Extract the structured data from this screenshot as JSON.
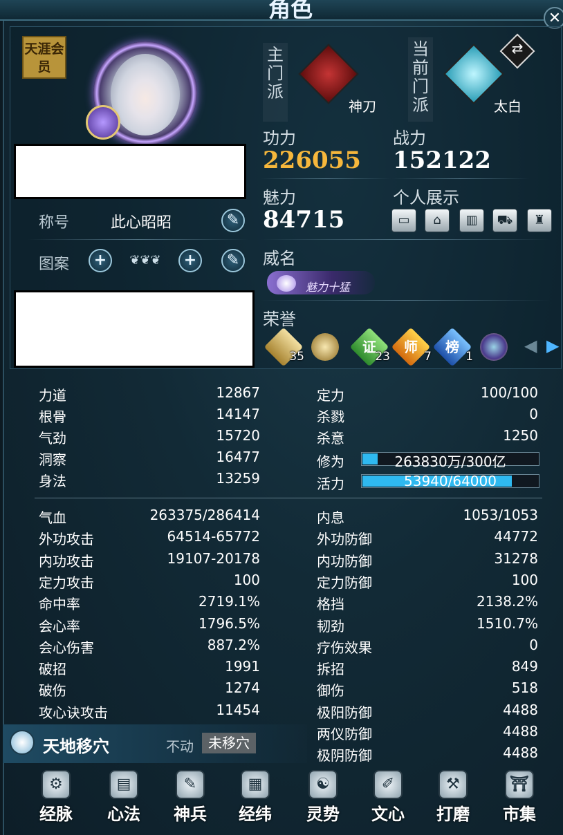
{
  "window": {
    "title": "角色",
    "close_label": "✕"
  },
  "profile": {
    "member_badge": "天涯会员",
    "title_label": "称号",
    "title_value": "此心昭昭",
    "pattern_label": "图案"
  },
  "schools": {
    "main_label": "主门派",
    "main_name": "神刀",
    "current_label": "当前门派",
    "current_name": "太白"
  },
  "stats_top": {
    "gongli_label": "功力",
    "gongli_value": "226055",
    "zhanli_label": "战力",
    "zhanli_value": "152122",
    "meili_label": "魅力",
    "meili_value": "84715",
    "showcase_label": "个人展示",
    "weiming_label": "威名",
    "weiming_badge": "魅力十猛",
    "honor_label": "荣誉"
  },
  "honors": [
    {
      "icon": "scroll-icon",
      "count": "35"
    },
    {
      "icon": "palette-icon",
      "count": ""
    },
    {
      "icon": "证",
      "count": "23"
    },
    {
      "icon": "师",
      "count": "7"
    },
    {
      "icon": "榜",
      "count": "1"
    },
    {
      "icon": "compass-icon",
      "count": ""
    }
  ],
  "attributes_left": [
    {
      "k": "力道",
      "v": "12867"
    },
    {
      "k": "根骨",
      "v": "14147"
    },
    {
      "k": "气劲",
      "v": "15720"
    },
    {
      "k": "洞察",
      "v": "16477"
    },
    {
      "k": "身法",
      "v": "13259"
    }
  ],
  "attributes_right": [
    {
      "k": "定力",
      "v": "100/100"
    },
    {
      "k": "杀戮",
      "v": "0"
    },
    {
      "k": "杀意",
      "v": "1250"
    }
  ],
  "bars": {
    "xiuwei_label": "修为",
    "xiuwei_text": "263830万/300亿",
    "xiuwei_fraction": 0.0088,
    "huoli_label": "活力",
    "huoli_text": "53940/64000",
    "huoli_fraction": 0.843
  },
  "combat_left": [
    {
      "k": "气血",
      "v": "263375/286414"
    },
    {
      "k": "外功攻击",
      "v": "64514-65772"
    },
    {
      "k": "内功攻击",
      "v": "19107-20178"
    },
    {
      "k": "定力攻击",
      "v": "100"
    },
    {
      "k": "命中率",
      "v": "2719.1%"
    },
    {
      "k": "会心率",
      "v": "1796.5%"
    },
    {
      "k": "会心伤害",
      "v": "887.2%"
    },
    {
      "k": "破招",
      "v": "1991"
    },
    {
      "k": "破伤",
      "v": "1274"
    },
    {
      "k": "攻心诀攻击",
      "v": "11454"
    }
  ],
  "combat_right": [
    {
      "k": "内息",
      "v": "1053/1053"
    },
    {
      "k": "外功防御",
      "v": "44772"
    },
    {
      "k": "内功防御",
      "v": "31278"
    },
    {
      "k": "定力防御",
      "v": "100"
    },
    {
      "k": "格挡",
      "v": "2138.2%"
    },
    {
      "k": "韧劲",
      "v": "1510.7%"
    },
    {
      "k": "疗伤效果",
      "v": "0"
    },
    {
      "k": "拆招",
      "v": "849"
    },
    {
      "k": "御伤",
      "v": "518"
    },
    {
      "k": "极阳防御",
      "v": "4488"
    },
    {
      "k": "两仪防御",
      "v": "4488"
    },
    {
      "k": "极阴防御",
      "v": "4488"
    }
  ],
  "acupoint": {
    "title": "天地移穴",
    "status": "不动",
    "button": "未移穴"
  },
  "nav": [
    {
      "label": "经脉",
      "icon": "meridian-icon",
      "glyph": "⚙"
    },
    {
      "label": "心法",
      "icon": "book-icon",
      "glyph": "▤"
    },
    {
      "label": "神兵",
      "icon": "feather-icon",
      "glyph": "✎"
    },
    {
      "label": "经纬",
      "icon": "grid-icon",
      "glyph": "▦"
    },
    {
      "label": "灵势",
      "icon": "swirl-icon",
      "glyph": "☯"
    },
    {
      "label": "文心",
      "icon": "brush-icon",
      "glyph": "✐"
    },
    {
      "label": "打磨",
      "icon": "hammer-icon",
      "glyph": "⚒"
    },
    {
      "label": "市集",
      "icon": "market-icon",
      "glyph": "⛩"
    }
  ]
}
